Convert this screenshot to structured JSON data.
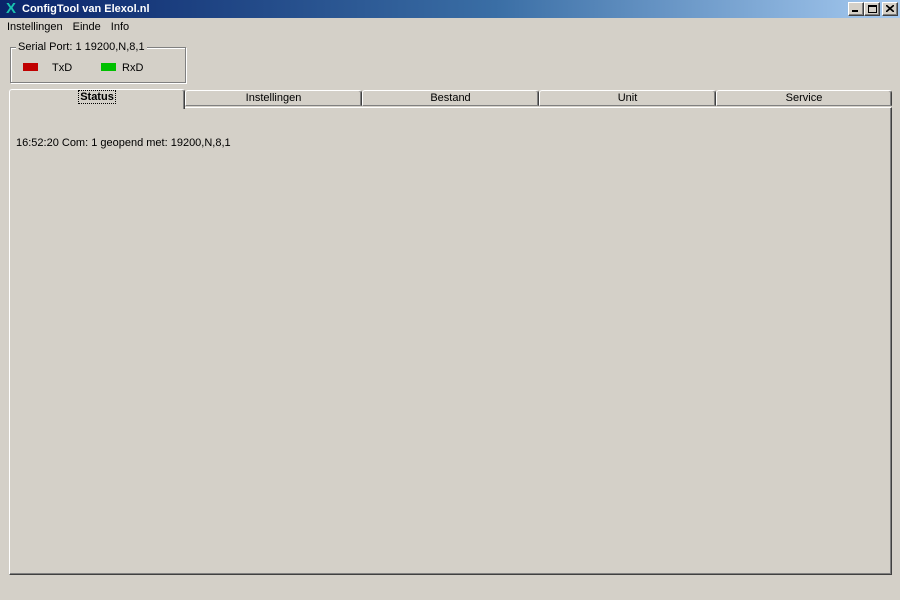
{
  "window": {
    "title": "ConfigTool van Elexol.nl",
    "icon": "x-app-icon",
    "caption_buttons": [
      "minimize-icon",
      "maximize-icon",
      "close-icon"
    ]
  },
  "menu": {
    "items": [
      {
        "label": "Instellingen"
      },
      {
        "label": "Einde"
      },
      {
        "label": "Info"
      }
    ]
  },
  "serial_port": {
    "label": "Serial Port: 1 19200,N,8,1",
    "indicators": [
      {
        "label": "TxD",
        "color": "#c00000"
      },
      {
        "label": "RxD",
        "color": "#00c000"
      }
    ]
  },
  "tabs": [
    {
      "label": "Status",
      "active": true
    },
    {
      "label": "Instellingen",
      "active": false
    },
    {
      "label": "Bestand",
      "active": false
    },
    {
      "label": "Unit",
      "active": false
    },
    {
      "label": "Service",
      "active": false
    }
  ],
  "status": {
    "log_lines": [
      "16:52:20 Com: 1 geopend met: 19200,N,8,1"
    ]
  },
  "colors": {
    "titlebar_start": "#0a246a",
    "titlebar_end": "#a6caf0",
    "face": "#d4d0c8"
  }
}
